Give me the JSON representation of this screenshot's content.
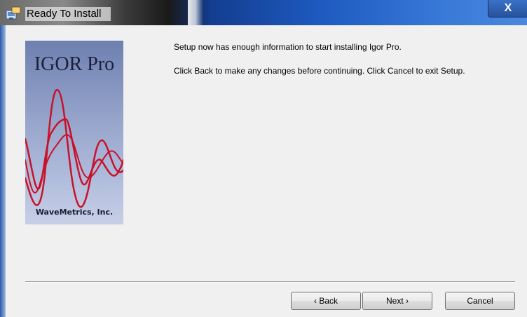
{
  "window": {
    "title": "Ready To Install",
    "close_label": "X"
  },
  "logo": {
    "title": "IGOR Pro",
    "company": "WaveMetrics, Inc."
  },
  "content": {
    "line1": "Setup now has enough information to start installing Igor Pro.",
    "line2": "Click Back to make any changes before continuing. Click Cancel to exit Setup."
  },
  "buttons": {
    "back": "‹ Back",
    "next": "Next ›",
    "cancel": "Cancel"
  },
  "colors": {
    "wave": "#c8122a",
    "dialog_bg": "#f0f0f0",
    "titlebar": "#1f5cc2"
  },
  "icons": {
    "title": "installer-icon",
    "close": "close-icon"
  }
}
